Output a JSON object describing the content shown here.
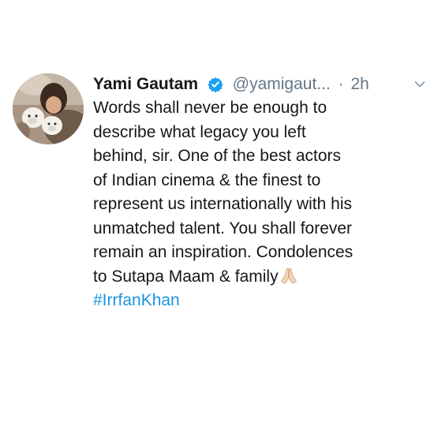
{
  "tweet": {
    "author": {
      "name": "Yami Gautam",
      "handle": "@yamigaut...",
      "verified_icon": "verified-badge-icon",
      "avatar_icon": "profile-photo-with-puppies"
    },
    "separator": "·",
    "timestamp": "2h",
    "menu_icon": "chevron-down-icon",
    "text_lines": [
      "Words shall never be enough to",
      "describe what legacy you left",
      "behind, sir. One of the best actors",
      "of  Indian cinema & the finest to",
      "represent us internationally with his",
      "unmatched talent. You shall forever",
      "remain an inspiration. Condolences",
      "to Sutapa Maam & family"
    ],
    "emoji": "folded-hands-icon",
    "hashtag": "#IrrfanKhan",
    "colors": {
      "text": "#14171a",
      "secondary": "#657786",
      "link": "#1b95e0",
      "verified": "#1da1f2"
    }
  }
}
